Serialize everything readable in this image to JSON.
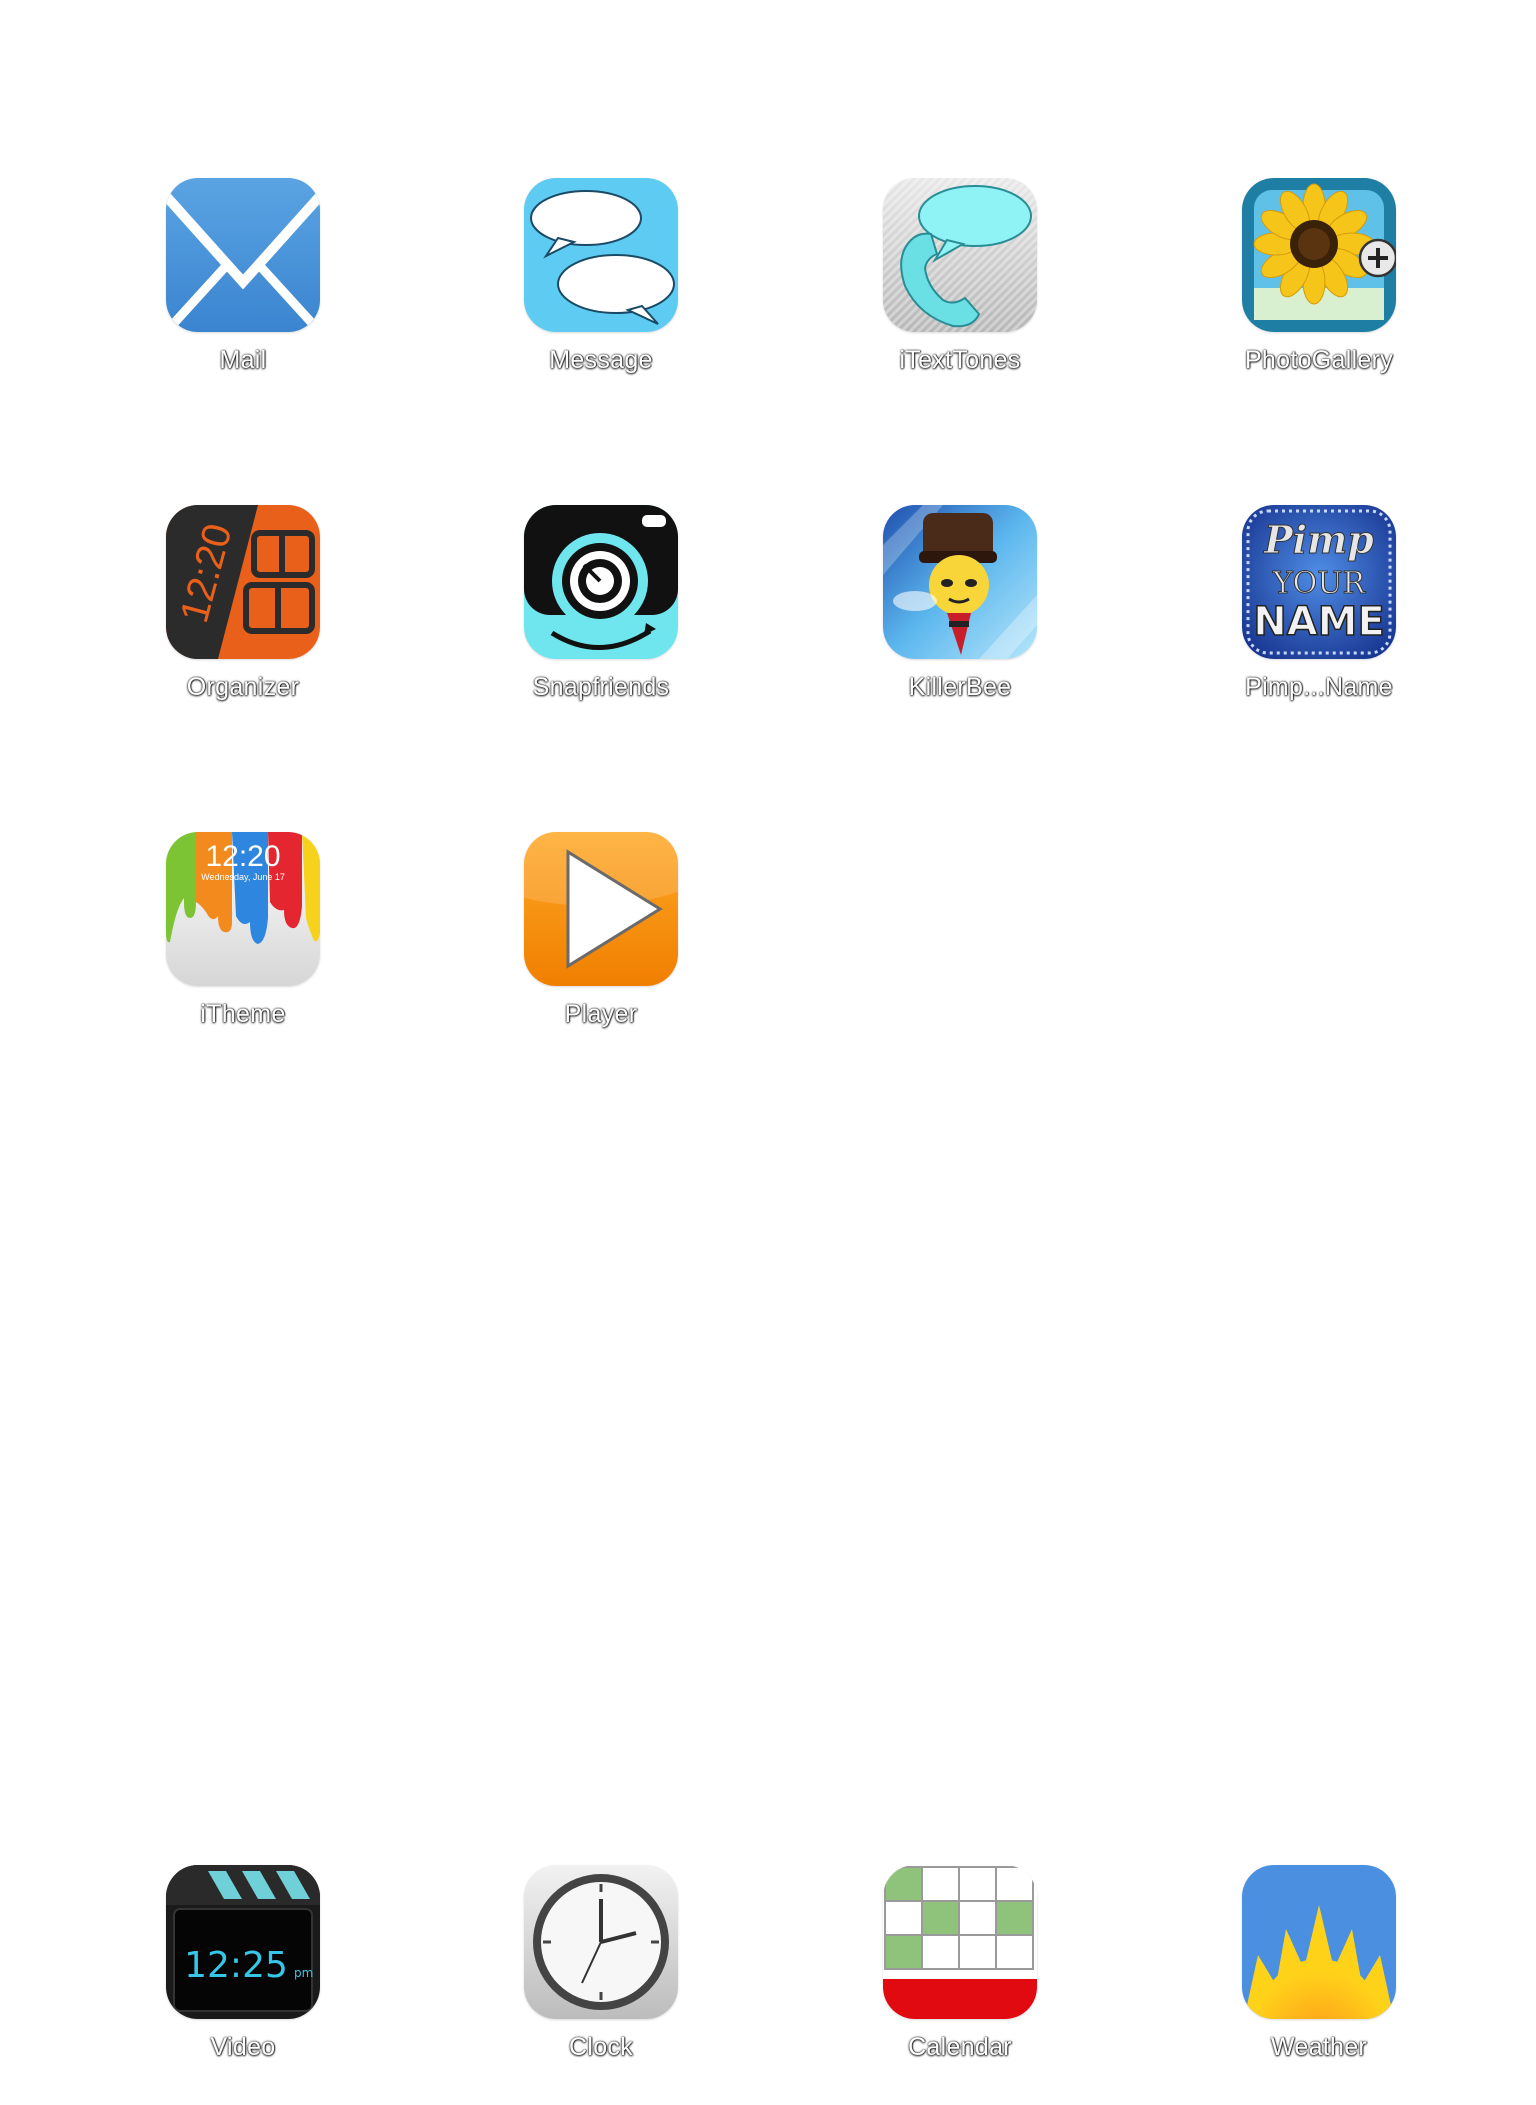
{
  "home_screen": {
    "apps": [
      {
        "label": "Mail",
        "icon": "mail-icon"
      },
      {
        "label": "Message",
        "icon": "message-icon"
      },
      {
        "label": "iTextTones",
        "icon": "itexttones-icon"
      },
      {
        "label": "PhotoGallery",
        "icon": "photogallery-icon"
      },
      {
        "label": "Organizer",
        "icon": "organizer-icon",
        "icon_text": "12:20"
      },
      {
        "label": "Snapfriends",
        "icon": "snapfriends-icon"
      },
      {
        "label": "KillerBee",
        "icon": "killerbee-icon"
      },
      {
        "label": "Pimp...Name",
        "icon": "pimp-your-name-icon",
        "icon_text": [
          "Pimp",
          "YOUR",
          "NAME"
        ]
      },
      {
        "label": "iTheme",
        "icon": "itheme-icon",
        "icon_text": [
          "12:20",
          "Wednesday, June 17"
        ]
      },
      {
        "label": "Player",
        "icon": "player-icon"
      }
    ]
  },
  "dock": {
    "apps": [
      {
        "label": "Video",
        "icon": "video-icon",
        "icon_text": [
          "12:25",
          "pm"
        ]
      },
      {
        "label": "Clock",
        "icon": "clock-icon"
      },
      {
        "label": "Calendar",
        "icon": "calendar-icon"
      },
      {
        "label": "Weather",
        "icon": "weather-icon"
      }
    ]
  }
}
